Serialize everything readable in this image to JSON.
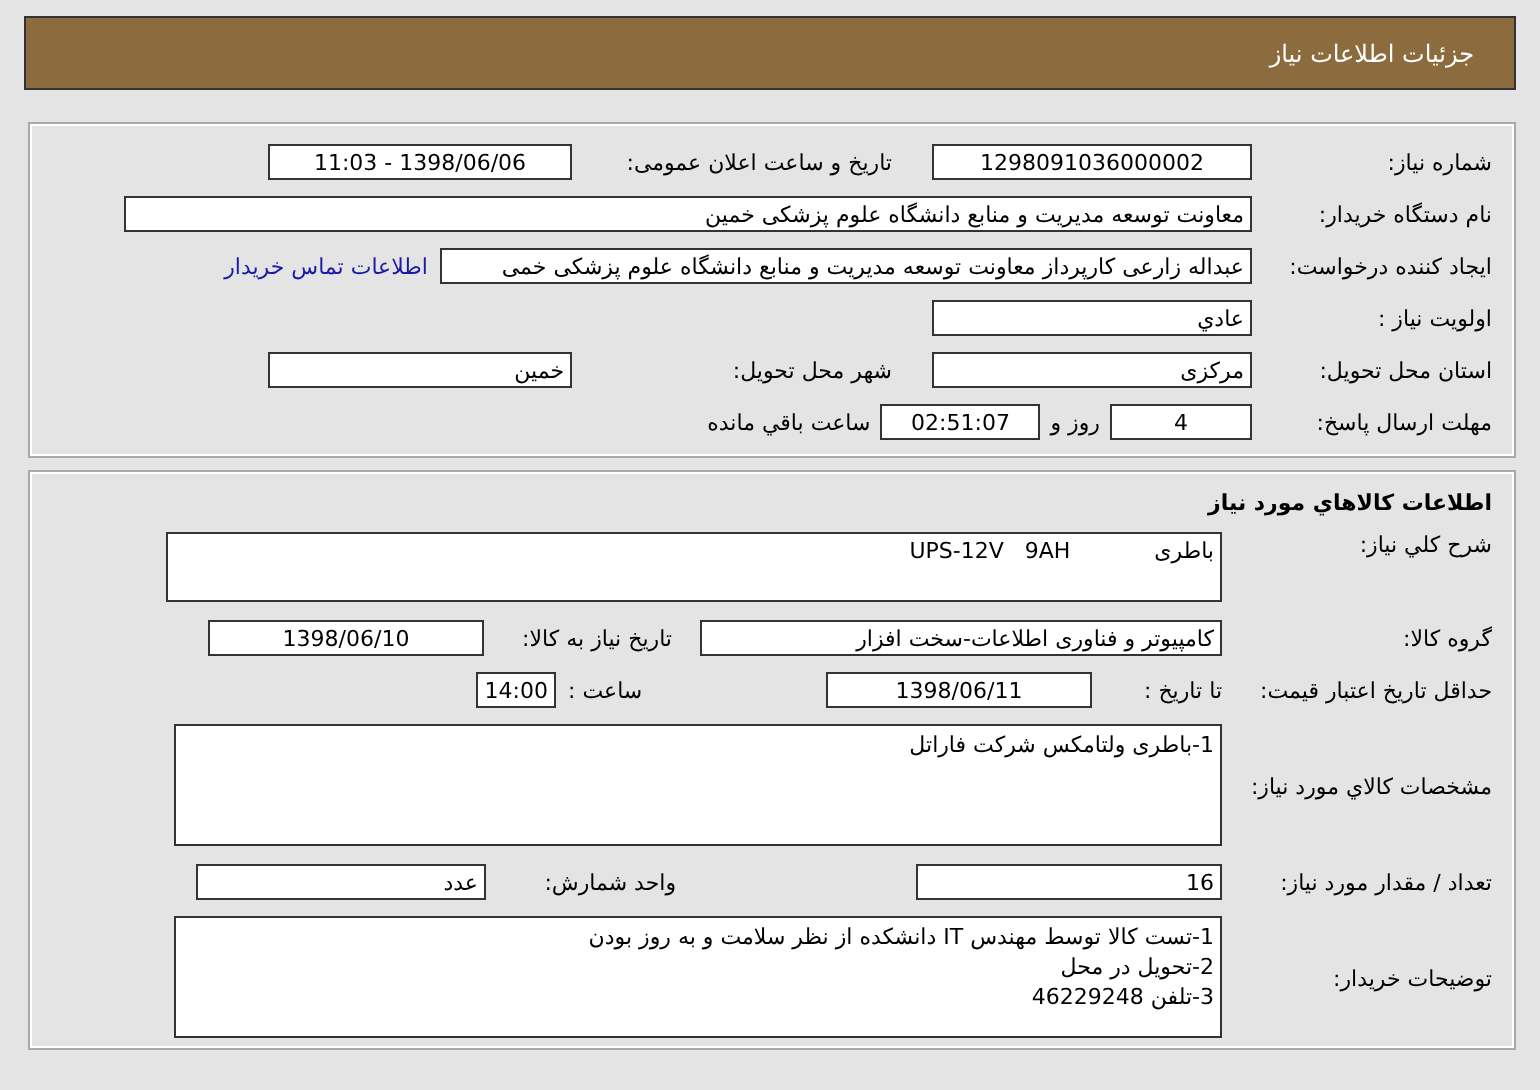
{
  "header": {
    "title": "جزئیات اطلاعات نیاز"
  },
  "request": {
    "need_number": {
      "label": "شماره نیاز:",
      "value": "1298091036000002"
    },
    "announce": {
      "label": "تاریخ و ساعت اعلان عمومی:",
      "value": "1398/06/06 - 11:03"
    },
    "buyer_org": {
      "label": "نام دستگاه خریدار:",
      "value": "معاونت توسعه مدیریت و منابع دانشگاه علوم پزشکی خمین"
    },
    "creator": {
      "label": "ایجاد کننده درخواست:",
      "value": "عبداله زارعی کارپرداز معاونت توسعه مدیریت و منابع دانشگاه علوم پزشکی خمی",
      "contact_link": "اطلاعات تماس خریدار"
    },
    "priority": {
      "label": "اولویت نیاز :",
      "value": "عادي"
    },
    "province": {
      "label": "استان محل تحویل:",
      "value": "مرکزی"
    },
    "city": {
      "label": "شهر محل تحویل:",
      "value": "خمین"
    },
    "deadline": {
      "label": "مهلت ارسال پاسخ:",
      "days": "4",
      "days_suffix": "روز و",
      "time": "02:51:07",
      "time_suffix": "ساعت باقي مانده"
    }
  },
  "goods": {
    "title": "اطلاعات کالاهاي مورد نیاز",
    "description": {
      "label": "شرح کلي نیاز:",
      "value": "باطری            UPS-12V   9AH"
    },
    "group": {
      "label": "گروه کالا:",
      "value": "کامپیوتر و فناوری اطلاعات-سخت افزار"
    },
    "need_date": {
      "label": "تاریخ نیاز به کالا:",
      "value": "1398/06/10"
    },
    "validity": {
      "label": "حداقل تاریخ اعتبار قیمت:",
      "date_label": "تا تاریخ :",
      "date": "1398/06/11",
      "time_label": "ساعت :",
      "time": "14:00"
    },
    "specs": {
      "label": "مشخصات کالاي مورد نیاز:",
      "value": "1-باطری ولتامکس شرکت فاراتل"
    },
    "quantity": {
      "label": "تعداد / مقدار مورد نیاز:",
      "value": "16"
    },
    "unit": {
      "label": "واحد شمارش:",
      "value": "عدد"
    },
    "notes": {
      "label": "توضیحات خریدار:",
      "lines": [
        "1-تست کالا توسط مهندس IT دانشکده از نظر سلامت و به روز بودن",
        "2-تحویل در محل",
        "3-تلفن 46229248"
      ]
    }
  }
}
